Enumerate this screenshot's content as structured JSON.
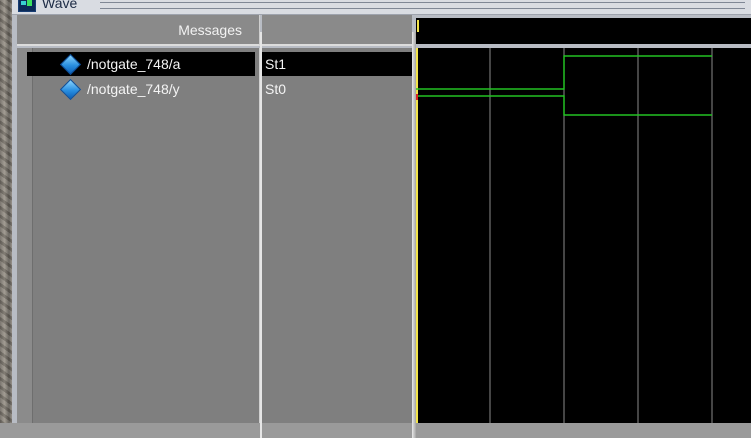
{
  "window": {
    "title": "Wave"
  },
  "headers": {
    "messages": "Messages"
  },
  "signals": [
    {
      "path": "/notgate_748/a",
      "value": "St1",
      "selected": true
    },
    {
      "path": "/notgate_748/y",
      "value": "St0",
      "selected": false
    }
  ],
  "waveform": {
    "transitions": [
      {
        "signal": "/notgate_748/a",
        "before": 0,
        "after": 1
      },
      {
        "signal": "/notgate_748/y",
        "before": 1,
        "after": 0
      }
    ]
  },
  "colors": {
    "wave": "#22c322",
    "cursor": "#f2e34a",
    "grid": "#8a8a8a",
    "selection": "#000000"
  }
}
